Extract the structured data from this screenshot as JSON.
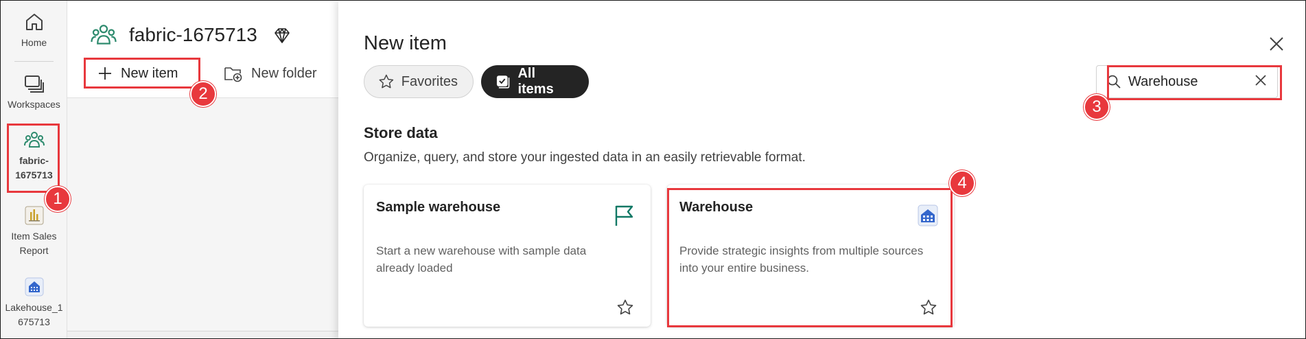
{
  "rail": {
    "items": [
      {
        "label": "Home",
        "icon": "home-icon"
      },
      {
        "label": "Workspaces",
        "icon": "workspaces-icon"
      },
      {
        "label": "fabric-1675713",
        "label_line1": "fabric-",
        "label_line2": "1675713",
        "icon": "workspace-people-icon"
      },
      {
        "label": "Item Sales Report",
        "label_line1": "Item Sales",
        "label_line2": "Report",
        "icon": "report-chart-icon"
      },
      {
        "label": "Lakehouse_1675713",
        "label_line1": "Lakehouse_1",
        "label_line2": "675713",
        "icon": "lakehouse-icon"
      }
    ]
  },
  "workspace": {
    "title": "fabric-1675713",
    "new_item_label": "New item",
    "new_folder_label": "New folder"
  },
  "dialog": {
    "title": "New item",
    "tabs": [
      {
        "label": "Favorites",
        "selected": false
      },
      {
        "label": "All items",
        "selected": true
      }
    ],
    "search": {
      "value": "Warehouse",
      "placeholder": "Search"
    },
    "section": {
      "title": "Store data",
      "description": "Organize, query, and store your ingested data in an easily retrievable format."
    },
    "cards": [
      {
        "title": "Sample warehouse",
        "description": "Start a new warehouse with sample data already loaded",
        "icon": "flag-icon"
      },
      {
        "title": "Warehouse",
        "description": "Provide strategic insights from multiple sources into your entire business.",
        "icon": "warehouse-icon"
      }
    ]
  },
  "annotations": [
    "1",
    "2",
    "3",
    "4"
  ],
  "colors": {
    "accent_green": "#2e8b6e",
    "highlight_red": "#e8383d",
    "dark_pill": "#242424",
    "warehouse_blue": "#3366cc"
  }
}
